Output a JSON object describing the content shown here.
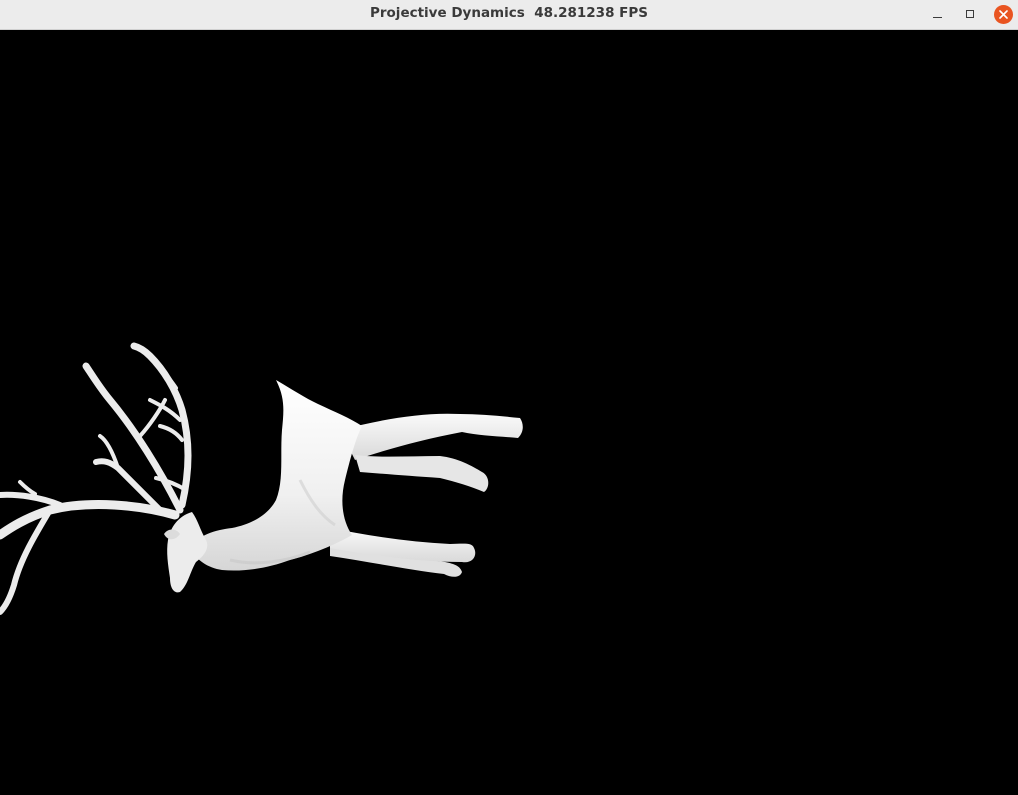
{
  "window": {
    "title": "Projective Dynamics  48.281238 FPS",
    "controls": {
      "minimize": "minimize-icon",
      "maximize": "maximize-icon",
      "close": "close-icon"
    }
  },
  "viewport": {
    "background_color": "#000000",
    "model_color": "#f2f2f2",
    "model": "deer-mesh"
  },
  "colors": {
    "titlebar": "#ececec",
    "close_button": "#e95420"
  }
}
